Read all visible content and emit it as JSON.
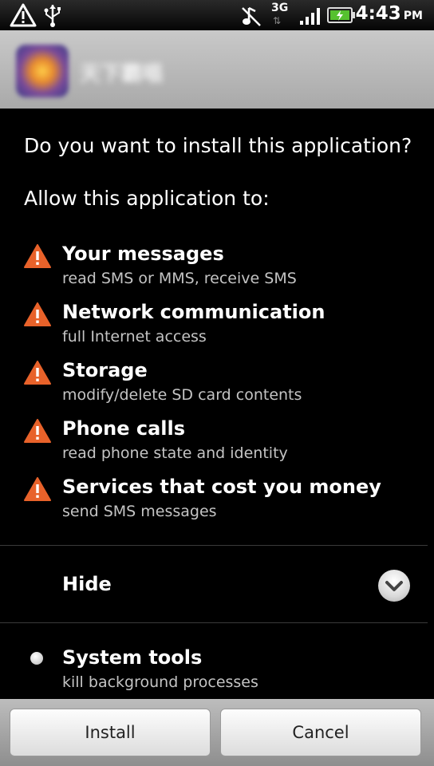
{
  "status_bar": {
    "time": "4:43",
    "ampm": "PM",
    "network_label": "3G",
    "icons": [
      "warning-icon",
      "usb-icon",
      "music-muted-icon",
      "network-3g-icon",
      "signal-bars-icon",
      "battery-charging-icon"
    ]
  },
  "app": {
    "name": "天下霸唱"
  },
  "prompt": {
    "question": "Do you want to install this application?",
    "allow_heading": "Allow this application to:"
  },
  "permissions": [
    {
      "title": "Your messages",
      "description": "read SMS or MMS, receive SMS"
    },
    {
      "title": "Network communication",
      "description": "full Internet access"
    },
    {
      "title": "Storage",
      "description": "modify/delete SD card contents"
    },
    {
      "title": "Phone calls",
      "description": "read phone state and identity"
    },
    {
      "title": "Services that cost you money",
      "description": "send SMS messages"
    }
  ],
  "toggle": {
    "label": "Hide"
  },
  "other_permissions": [
    {
      "title": "System tools",
      "description": "kill background processes"
    }
  ],
  "buttons": {
    "install": "Install",
    "cancel": "Cancel"
  },
  "colors": {
    "warning": "#e8622a",
    "background": "#000000",
    "header": "#b5b5b5",
    "secondary_text": "#c4c4c4"
  }
}
